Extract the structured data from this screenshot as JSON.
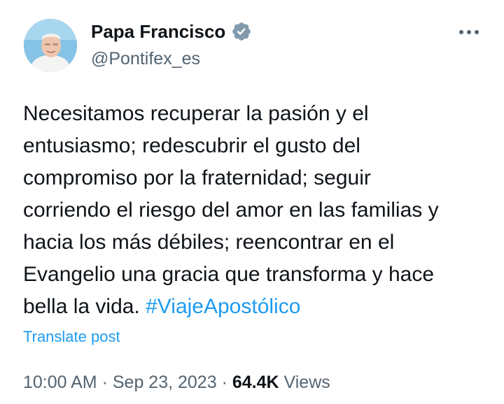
{
  "author": {
    "display_name": "Papa Francisco",
    "handle": "@Pontifex_es",
    "verified_icon": "verified-badge-icon"
  },
  "post": {
    "text_lines": [
      "Necesitamos recuperar la pasión y el",
      "entusiasmo; redescubrir el gusto del",
      "compromiso por la fraternidad; seguir",
      "corriendo el riesgo del amor en las familias y",
      "hacia los más débiles; reencontrar en el",
      "Evangelio una gracia que transforma y hace",
      "bella la vida."
    ],
    "hashtag": "#ViajeApostólico",
    "translate_label": "Translate post"
  },
  "meta": {
    "time": "10:00 AM",
    "separator": "·",
    "date": "Sep 23, 2023",
    "views_count": "64.4K",
    "views_label": "Views"
  },
  "colors": {
    "text": "#0f1419",
    "secondary": "#536471",
    "accent": "#1d9bf0"
  }
}
